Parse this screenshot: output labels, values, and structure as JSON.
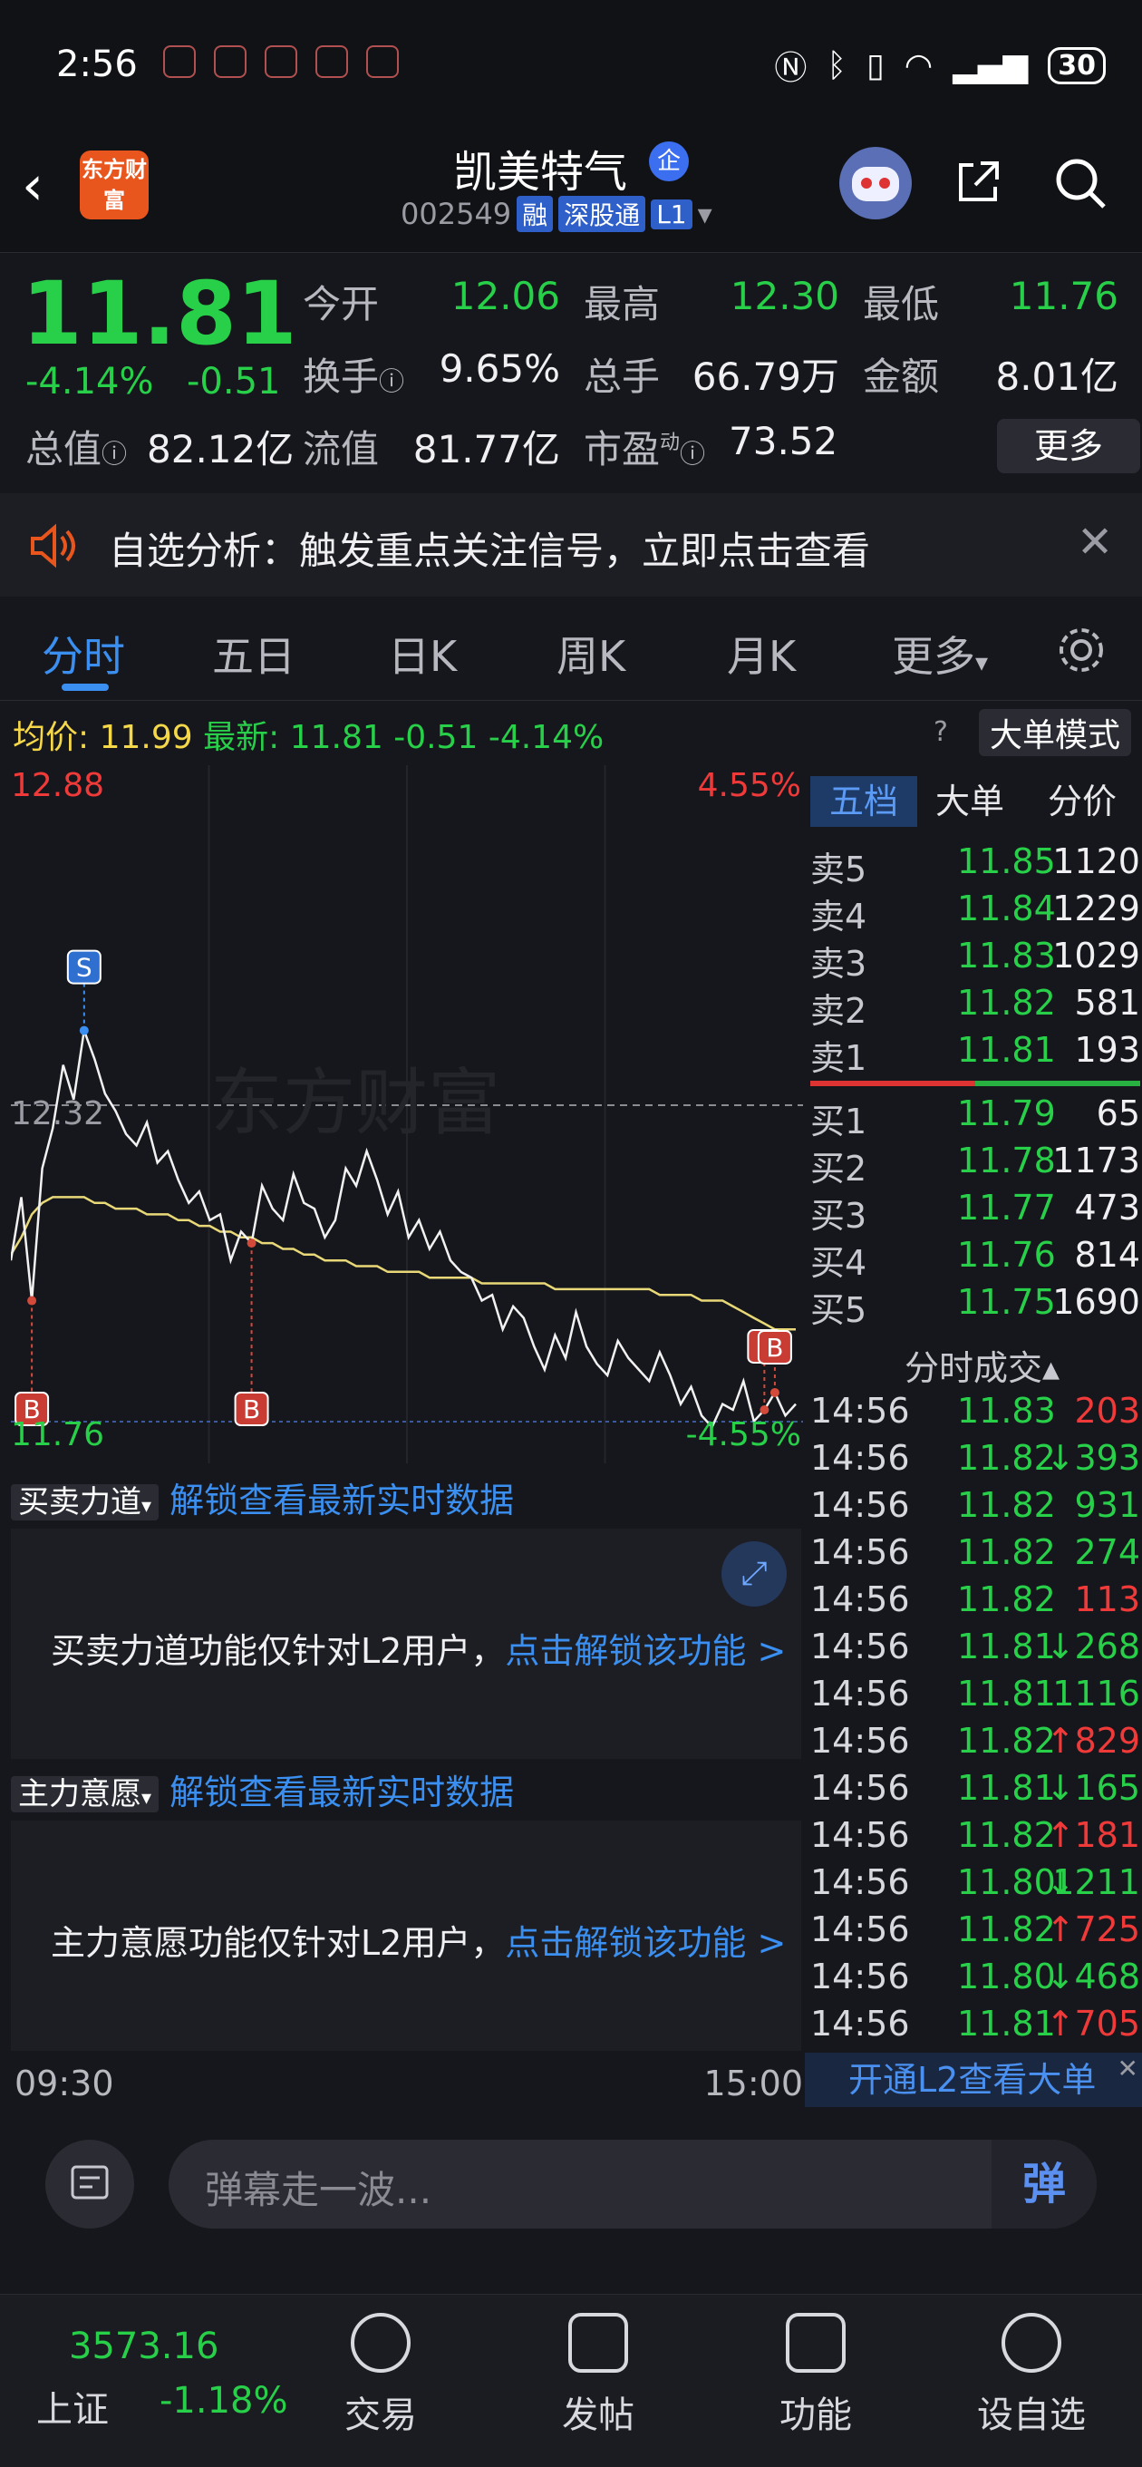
{
  "status_bar": {
    "time": "2:56",
    "battery": "30"
  },
  "header": {
    "logo_text": "东方财富",
    "stock_name": "凯美特气",
    "badge": "企",
    "code": "002549",
    "tags": [
      "融",
      "深股通",
      "L1"
    ]
  },
  "quote": {
    "price": "11.81",
    "pct": "-4.14%",
    "change": "-0.51",
    "fields": [
      {
        "label": "今开",
        "value": "12.06",
        "color": "#28d04a"
      },
      {
        "label": "最高",
        "value": "12.30",
        "color": "#28d04a"
      },
      {
        "label": "最低",
        "value": "11.76",
        "color": "#28d04a"
      },
      {
        "label": "换手",
        "value": "9.65%",
        "color": "#f0f0f2"
      },
      {
        "label": "总手",
        "value": "66.79万",
        "color": "#f0f0f2"
      },
      {
        "label": "金额",
        "value": "8.01亿",
        "color": "#f0f0f2"
      },
      {
        "label": "总值",
        "value": "82.12亿",
        "color": "#f0f0f2"
      },
      {
        "label": "流值",
        "value": "81.77亿",
        "color": "#f0f0f2"
      },
      {
        "label": "市盈",
        "value": "73.52",
        "color": "#f0f0f2"
      }
    ],
    "pe_superscript": "动",
    "more_label": "更多"
  },
  "notice": {
    "text": "自选分析：触发重点关注信号，立即点击查看"
  },
  "tabs": [
    "分时",
    "五日",
    "日K",
    "周K",
    "月K",
    "更多"
  ],
  "avg_bar": {
    "avg_label": "均价:",
    "avg_value": "11.99",
    "latest_label": "最新:",
    "latest_value": "11.81",
    "latest_change": "-0.51",
    "latest_pct": "-4.14%",
    "big_order_mode": "大单模式"
  },
  "chart_data": {
    "type": "line",
    "top_price_label": "12.88",
    "top_pct_label": "4.55%",
    "ref_price_label": "12.32",
    "low_price_label": "11.76",
    "low_pct_label": "-4.55%",
    "watermark": "东方财富",
    "x_start": "09:30",
    "x_end": "15:00",
    "ylim": [
      11.76,
      12.88
    ],
    "prev_close": 12.32,
    "price_series": {
      "name": "最新",
      "values": [
        12.05,
        12.16,
        11.98,
        12.21,
        12.28,
        12.39,
        12.33,
        12.45,
        12.4,
        12.34,
        12.31,
        12.27,
        12.25,
        12.29,
        12.22,
        12.24,
        12.19,
        12.15,
        12.17,
        12.12,
        12.13,
        12.05,
        12.1,
        12.08,
        12.18,
        12.14,
        12.12,
        12.2,
        12.15,
        12.14,
        12.09,
        12.12,
        12.21,
        12.18,
        12.24,
        12.19,
        12.13,
        12.17,
        12.09,
        12.12,
        12.07,
        12.1,
        12.05,
        12.03,
        12.02,
        11.98,
        11.99,
        11.93,
        11.97,
        11.95,
        11.9,
        11.86,
        11.92,
        11.88,
        11.96,
        11.9,
        11.87,
        11.85,
        11.91,
        11.88,
        11.86,
        11.84,
        11.89,
        11.85,
        11.8,
        11.83,
        11.78,
        11.76,
        11.8,
        11.79,
        11.84,
        11.77,
        11.79,
        11.82,
        11.78,
        11.8
      ]
    },
    "avg_series": {
      "name": "均价",
      "values": [
        12.06,
        12.09,
        12.13,
        12.15,
        12.16,
        12.16,
        12.16,
        12.16,
        12.15,
        12.15,
        12.14,
        12.14,
        12.14,
        12.13,
        12.13,
        12.13,
        12.12,
        12.12,
        12.11,
        12.11,
        12.1,
        12.1,
        12.09,
        12.09,
        12.08,
        12.08,
        12.07,
        12.07,
        12.06,
        12.06,
        12.05,
        12.05,
        12.05,
        12.04,
        12.04,
        12.04,
        12.03,
        12.03,
        12.03,
        12.03,
        12.02,
        12.02,
        12.02,
        12.02,
        12.02,
        12.01,
        12.01,
        12.01,
        12.01,
        12.01,
        12.01,
        12.01,
        12.0,
        12.0,
        12.0,
        12.0,
        12.0,
        12.0,
        12.0,
        12.0,
        12.0,
        12.0,
        11.99,
        11.99,
        11.99,
        11.99,
        11.98,
        11.98,
        11.98,
        11.97,
        11.96,
        11.95,
        11.94,
        11.93,
        11.93,
        11.93
      ]
    },
    "markers": [
      {
        "label": "B",
        "index": 2
      },
      {
        "label": "S",
        "index": 7
      },
      {
        "label": "B",
        "index": 23
      },
      {
        "label": "B",
        "index": 72
      },
      {
        "label": "B",
        "index": 73
      }
    ]
  },
  "side": {
    "tabs": [
      "五档",
      "大单",
      "分价"
    ],
    "asks": [
      {
        "label": "卖5",
        "price": "11.85",
        "vol": "1120"
      },
      {
        "label": "卖4",
        "price": "11.84",
        "vol": "1229"
      },
      {
        "label": "卖3",
        "price": "11.83",
        "vol": "1029"
      },
      {
        "label": "卖2",
        "price": "11.82",
        "vol": "581"
      },
      {
        "label": "卖1",
        "price": "11.81",
        "vol": "193"
      }
    ],
    "bids": [
      {
        "label": "买1",
        "price": "11.79",
        "vol": "65"
      },
      {
        "label": "买2",
        "price": "11.78",
        "vol": "1173"
      },
      {
        "label": "买3",
        "price": "11.77",
        "vol": "473"
      },
      {
        "label": "买4",
        "price": "11.76",
        "vol": "814"
      },
      {
        "label": "买5",
        "price": "11.75",
        "vol": "1690"
      }
    ],
    "trades_title": "分时成交",
    "trades": [
      {
        "time": "14:56",
        "price": "11.83",
        "arrow": "",
        "vol": "203",
        "color": "#f03a3a"
      },
      {
        "time": "14:56",
        "price": "11.82",
        "arrow": "↓",
        "vol": "393",
        "color": "#28d04a"
      },
      {
        "time": "14:56",
        "price": "11.82",
        "arrow": "",
        "vol": "931",
        "color": "#28d04a"
      },
      {
        "time": "14:56",
        "price": "11.82",
        "arrow": "",
        "vol": "274",
        "color": "#28d04a"
      },
      {
        "time": "14:56",
        "price": "11.82",
        "arrow": "",
        "vol": "113",
        "color": "#f03a3a"
      },
      {
        "time": "14:56",
        "price": "11.81",
        "arrow": "↓",
        "vol": "268",
        "color": "#28d04a"
      },
      {
        "time": "14:56",
        "price": "11.81",
        "arrow": "",
        "vol": "1116",
        "color": "#28d04a"
      },
      {
        "time": "14:56",
        "price": "11.82",
        "arrow": "↑",
        "vol": "829",
        "color": "#f03a3a"
      },
      {
        "time": "14:56",
        "price": "11.81",
        "arrow": "↓",
        "vol": "165",
        "color": "#28d04a"
      },
      {
        "time": "14:56",
        "price": "11.82",
        "arrow": "↑",
        "vol": "181",
        "color": "#f03a3a"
      },
      {
        "time": "14:56",
        "price": "11.80",
        "arrow": "↓",
        "vol": "1211",
        "color": "#28d04a"
      },
      {
        "time": "14:56",
        "price": "11.82",
        "arrow": "↑",
        "vol": "725",
        "color": "#f03a3a"
      },
      {
        "time": "14:56",
        "price": "11.80",
        "arrow": "↓",
        "vol": "468",
        "color": "#28d04a"
      },
      {
        "time": "14:56",
        "price": "11.81",
        "arrow": "↑",
        "vol": "705",
        "color": "#f03a3a"
      }
    ],
    "l2_link": "开通L2查看大单"
  },
  "panels": [
    {
      "dropdown": "买卖力道",
      "unlock": "解锁查看最新实时数据",
      "message": "买卖力道功能仅针对L2用户，",
      "link": "点击解锁该功能 >"
    },
    {
      "dropdown": "主力意愿",
      "unlock": "解锁查看最新实时数据",
      "message": "主力意愿功能仅针对L2用户，",
      "link": "点击解锁该功能 >"
    }
  ],
  "danmu": {
    "placeholder": "弹幕走一波...",
    "send": "弹"
  },
  "bottom_nav": {
    "index_value": "3573.16",
    "index_name": "上证",
    "index_pct": "-1.18%",
    "items": [
      "交易",
      "发帖",
      "功能",
      "设自选"
    ]
  }
}
